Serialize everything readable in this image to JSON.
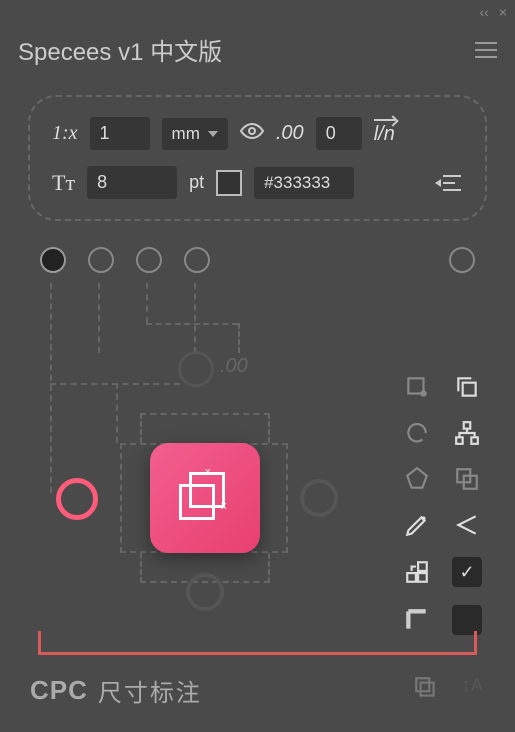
{
  "titlebar": {
    "collapse": "‹‹",
    "close": "×"
  },
  "header": {
    "title": "Specees v1 中文版"
  },
  "settings": {
    "scale_label": "1:x",
    "scale_value": "1",
    "unit": "mm",
    "decimals_label": ".00",
    "decimals_value": "0",
    "line_notation": "l/n",
    "font_label": "Tᴛ",
    "font_size": "8",
    "font_unit": "pt",
    "hex": "#333333"
  },
  "stage": {
    "decimal_hint": ".00"
  },
  "footer": {
    "brand": "CPC",
    "label": "尺寸标注"
  },
  "icons": {
    "eye": "eye-icon",
    "hamburger": "menu-icon"
  }
}
